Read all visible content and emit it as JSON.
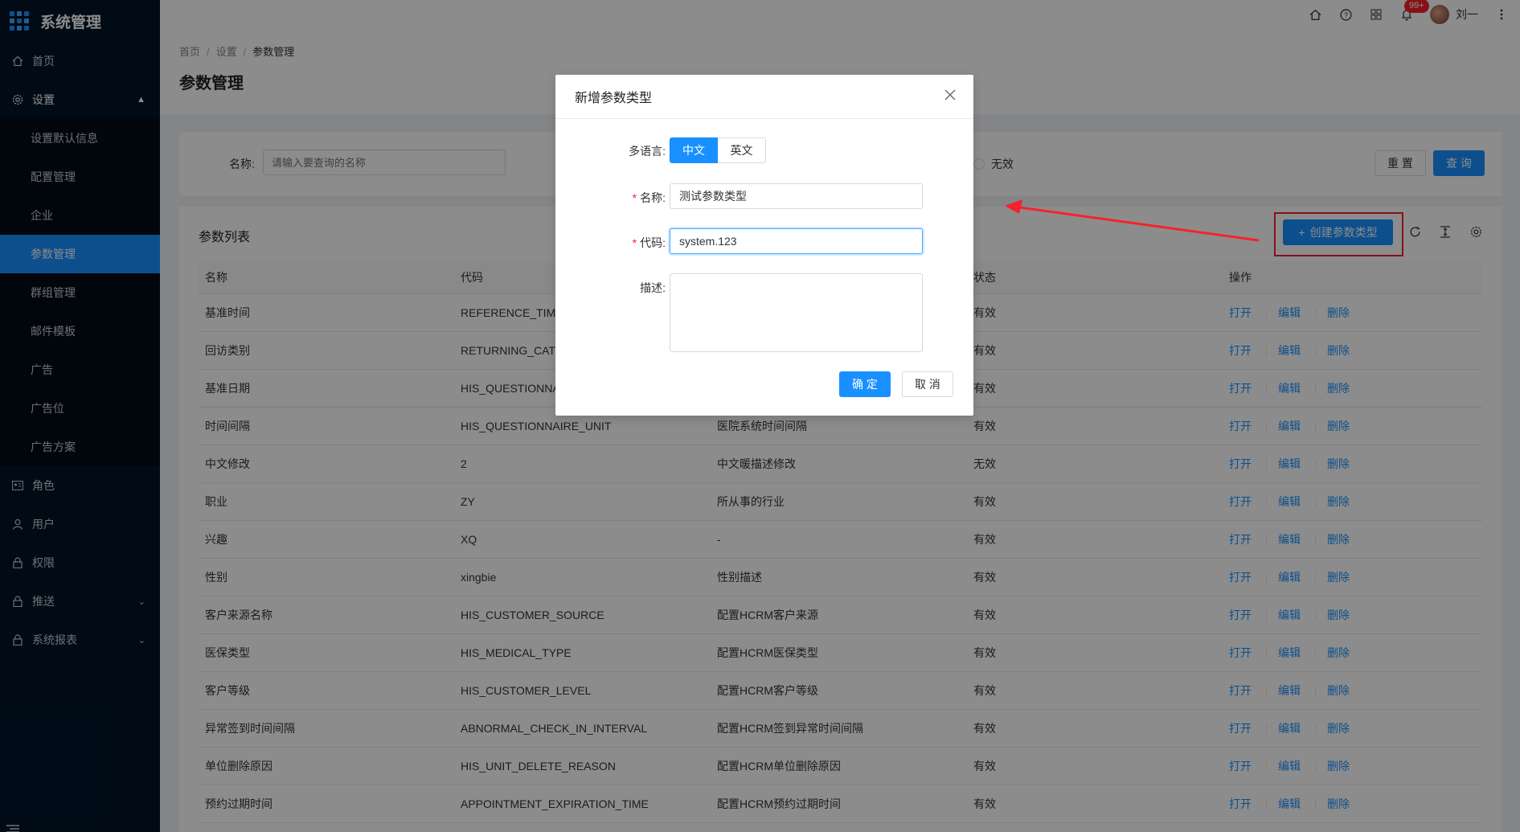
{
  "app": {
    "title": "系统管理"
  },
  "sidebar": {
    "home": "首页",
    "settings": "设置",
    "settings_children": [
      "设置默认信息",
      "配置管理",
      "企业",
      "参数管理",
      "群组管理",
      "邮件模板",
      "广告",
      "广告位",
      "广告方案"
    ],
    "role": "角色",
    "user": "用户",
    "permission": "权限",
    "push": "推送",
    "report": "系统报表"
  },
  "header": {
    "badge": "99+",
    "username": "刘一"
  },
  "breadcrumb": {
    "home": "首页",
    "settings": "设置",
    "current": "参数管理"
  },
  "page": {
    "title": "参数管理"
  },
  "search": {
    "name_label": "名称:",
    "name_placeholder": "请输入要查询的名称",
    "status_invalid": "无效",
    "reset": "重 置",
    "query": "查 询"
  },
  "list": {
    "title": "参数列表",
    "create": "创建参数类型",
    "headers": [
      "名称",
      "代码",
      "",
      "状态",
      "操作"
    ],
    "actions": [
      "打开",
      "编辑",
      "删除"
    ],
    "rows": [
      [
        "基准时间",
        "REFERENCE_TIME",
        "",
        "有效"
      ],
      [
        "回访类别",
        "RETURNING_CATEG",
        "",
        "有效"
      ],
      [
        "基准日期",
        "HIS_QUESTIONNAI",
        "",
        "有效"
      ],
      [
        "时间间隔",
        "HIS_QUESTIONNAIRE_UNIT",
        "医院系统时间间隔",
        "有效"
      ],
      [
        "中文修改",
        "2",
        "中文暖描述修改",
        "无效"
      ],
      [
        "职业",
        "ZY",
        "所从事的行业",
        "有效"
      ],
      [
        "兴趣",
        "XQ",
        "-",
        "有效"
      ],
      [
        "性别",
        "xingbie",
        "性别描述",
        "有效"
      ],
      [
        "客户来源名称",
        "HIS_CUSTOMER_SOURCE",
        "配置HCRM客户来源",
        "有效"
      ],
      [
        "医保类型",
        "HIS_MEDICAL_TYPE",
        "配置HCRM医保类型",
        "有效"
      ],
      [
        "客户等级",
        "HIS_CUSTOMER_LEVEL",
        "配置HCRM客户等级",
        "有效"
      ],
      [
        "异常签到时间间隔",
        "ABNORMAL_CHECK_IN_INTERVAL",
        "配置HCRM签到异常时间间隔",
        "有效"
      ],
      [
        "单位删除原因",
        "HIS_UNIT_DELETE_REASON",
        "配置HCRM单位删除原因",
        "有效"
      ],
      [
        "预约过期时间",
        "APPOINTMENT_EXPIRATION_TIME",
        "配置HCRM预约过期时间",
        "有效"
      ]
    ]
  },
  "modal": {
    "title": "新增参数类型",
    "lang_label": "多语言:",
    "lang_zh": "中文",
    "lang_en": "英文",
    "name_label": "名称:",
    "name_value": "测试参数类型",
    "code_label": "代码:",
    "code_value": "system.123",
    "desc_label": "描述:",
    "desc_value": "",
    "ok": "确 定",
    "cancel": "取 消"
  },
  "colors": {
    "primary": "#1890ff",
    "sidebar": "#001529",
    "annotation": "#f5222d"
  }
}
